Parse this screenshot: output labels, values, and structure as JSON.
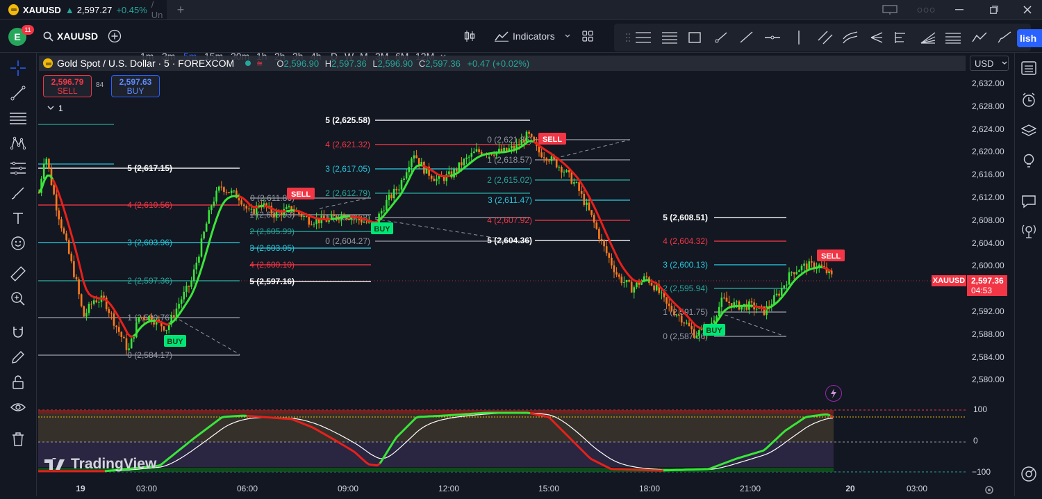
{
  "window": {
    "symbol": "XAUUSD",
    "arrow": "▲",
    "price": "2,597.27",
    "change": "+0.45%",
    "rest": "/ Un",
    "add_tab": "+"
  },
  "toolbar": {
    "avatar_letter": "E",
    "notification_count": "11",
    "search_symbol": "XAUUSD",
    "intervals": [
      "1m",
      "3m",
      "5m",
      "15m",
      "30m",
      "1h",
      "2h",
      "3h",
      "4h",
      "D",
      "W",
      "M",
      "3M",
      "6M",
      "12M"
    ],
    "active_interval": "5m",
    "indicators_label": "Indicators",
    "publish_label": "lish"
  },
  "legend": {
    "title": "Gold Spot / U.S. Dollar · 5 · FOREXCOM",
    "o_label": "O",
    "o": "2,596.90",
    "h_label": "H",
    "h": "2,597.36",
    "l_label": "L",
    "l": "2,596.90",
    "c_label": "C",
    "c": "2,597.36",
    "change": "+0.47 (+0.02%)",
    "collapse_count": "1"
  },
  "trade": {
    "sell_price": "2,596.79",
    "sell_label": "SELL",
    "spread": "84",
    "buy_price": "2,597.63",
    "buy_label": "BUY"
  },
  "currency_select": "USD",
  "price_axis": [
    "2,632.00",
    "2,628.00",
    "2,624.00",
    "2,620.00",
    "2,616.00",
    "2,612.00",
    "2,608.00",
    "2,604.00",
    "2,600.00",
    "2,596.00",
    "2,592.00",
    "2,588.00",
    "2,584.00",
    "2,580.00"
  ],
  "oscillator_axis": [
    "100",
    "0",
    "−100"
  ],
  "time_axis": [
    "19",
    "03:00",
    "06:00",
    "09:00",
    "12:00",
    "15:00",
    "18:00",
    "21:00",
    "20",
    "03:00"
  ],
  "current_price": {
    "symbol_tag": "XAUUSD",
    "price": "2,597.36",
    "countdown": "04:53"
  },
  "watermark": "TradingView",
  "colors": {
    "up": "#26a69a",
    "down": "#f23645",
    "accent": "#2962ff",
    "ma_green": "#39e639",
    "ma_red": "#e8201a"
  },
  "fib_sets": [
    {
      "labels": [
        "5 (2,617.15)",
        "4 (2,610.56)",
        "3 (2,603.96)",
        "2 (2,597.36)",
        "1 (2,590.76)",
        "0 (2,584.17)"
      ]
    },
    {
      "labels": [
        "0 (2,611.86)",
        "1 (2,608.93)",
        "2 (2,605.99)",
        "3 (2,603.05)",
        "4 (2,600.10)",
        "5 (2,597.16)"
      ]
    },
    {
      "labels": [
        "5 (2,625.58)",
        "4 (2,621.32)",
        "3 (2,617.05)",
        "2 (2,612.79)",
        "1 (2,608.53)",
        "0 (2,604.27)"
      ]
    },
    {
      "labels": [
        "0 (2,621.86)",
        "1 (2,618.57)",
        "2 (2,615.02)",
        "3 (2,611.47)",
        "4 (2,607.92)",
        "5 (2,604.36)"
      ]
    },
    {
      "labels": [
        "5 (2,608.51)",
        "4 (2,604.32)",
        "3 (2,600.13)",
        "2 (2,595.94)",
        "1 (2,591.75)",
        "0 (2,587.56)"
      ]
    }
  ],
  "signals": [
    {
      "label": "BUY",
      "type": "buy"
    },
    {
      "label": "SELL",
      "type": "sell"
    },
    {
      "label": "BUY",
      "type": "buy"
    },
    {
      "label": "SELL",
      "type": "sell"
    },
    {
      "label": "BUY",
      "type": "buy"
    },
    {
      "label": "SELL",
      "type": "sell"
    }
  ]
}
